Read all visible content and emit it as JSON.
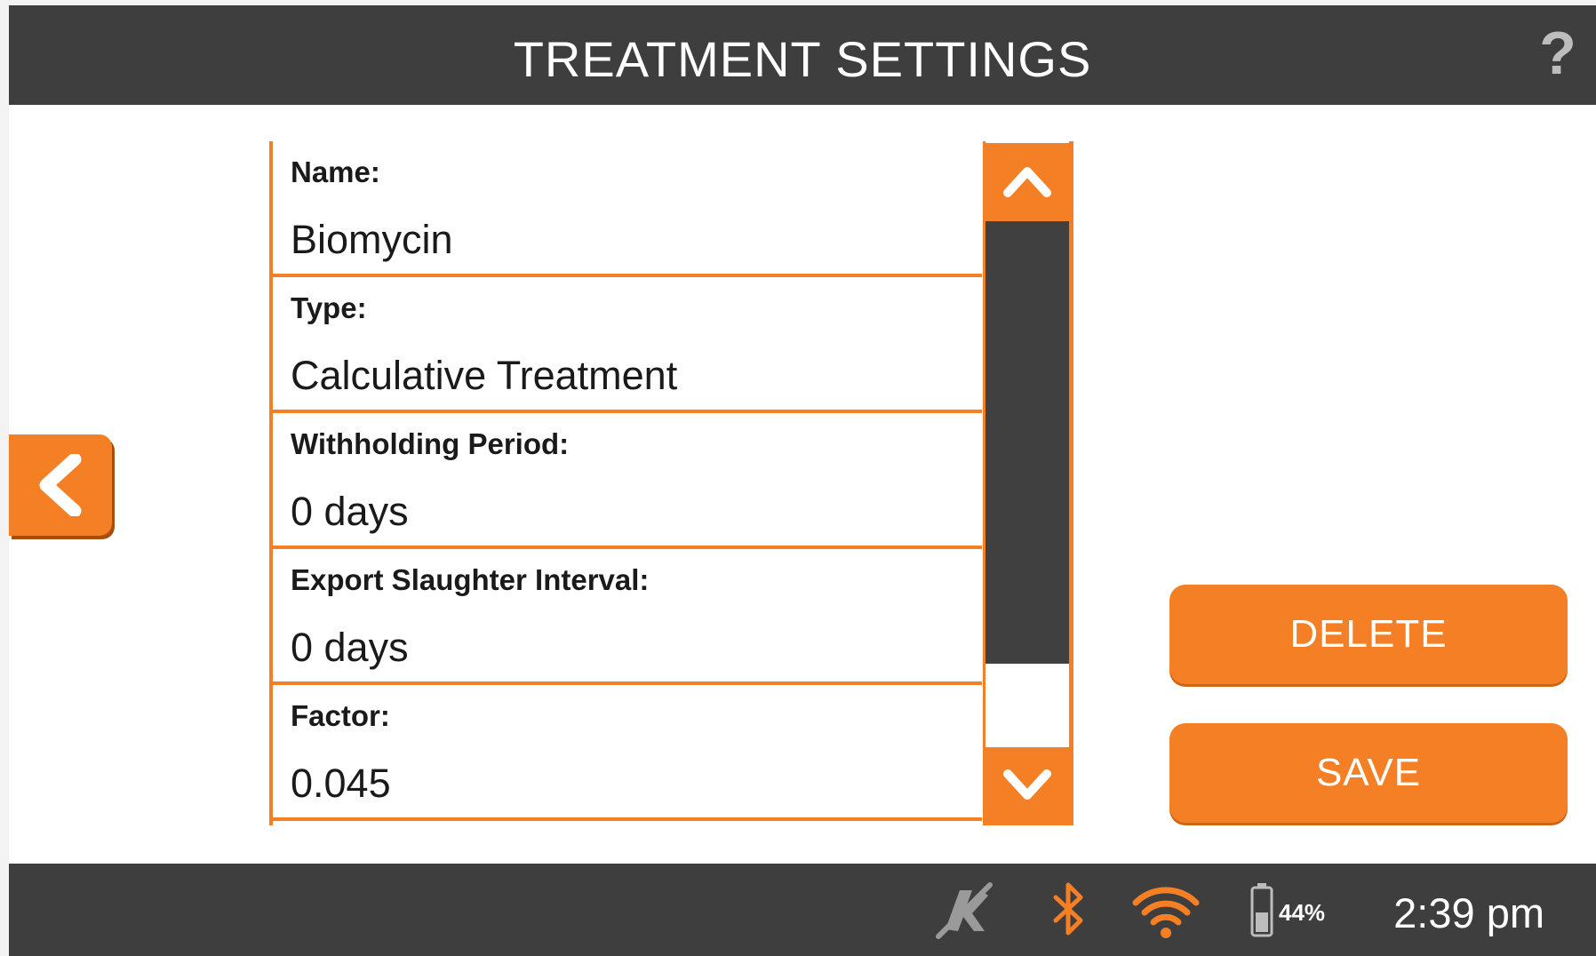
{
  "header": {
    "title": "TREATMENT SETTINGS",
    "help_icon": "?"
  },
  "nav": {
    "back_icon": "chevron-left-icon"
  },
  "fields": [
    {
      "label": "Name:",
      "value": "Biomycin"
    },
    {
      "label": "Type:",
      "value": "Calculative Treatment"
    },
    {
      "label": "Withholding Period:",
      "value": "0 days"
    },
    {
      "label": "Export Slaughter Interval:",
      "value": "0 days"
    },
    {
      "label": "Factor:",
      "value": "0.045"
    }
  ],
  "scroll": {
    "up_icon": "chevron-up-icon",
    "down_icon": "chevron-down-icon"
  },
  "actions": {
    "delete_label": "DELETE",
    "save_label": "SAVE"
  },
  "status": {
    "scale_icon": "scale-disconnected-icon",
    "bluetooth_icon": "bluetooth-icon",
    "wifi_icon": "wifi-icon",
    "battery_icon": "battery-icon",
    "battery_percent": "44%",
    "time": "2:39 pm"
  },
  "colors": {
    "accent": "#f47f24",
    "bar": "#3e3e3e",
    "scroll_thumb": "#404040"
  }
}
